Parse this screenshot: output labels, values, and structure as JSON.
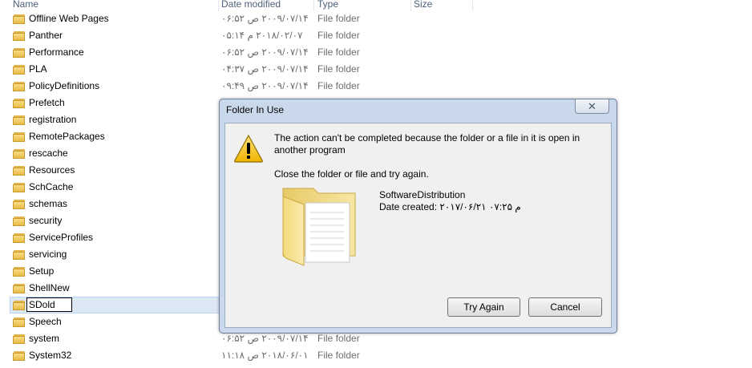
{
  "columns": {
    "name": "Name",
    "date_modified": "Date modified",
    "type": "Type",
    "size": "Size"
  },
  "files": [
    {
      "name": "Offline Web Pages",
      "date": "۲۰۰۹/۰۷/۱۴ ص ۰۶:۵۲",
      "type": "File folder"
    },
    {
      "name": "Panther",
      "date": "۲۰۱۸/۰۲/۰۷ م ۰۵:۱۴",
      "type": "File folder"
    },
    {
      "name": "Performance",
      "date": "۲۰۰۹/۰۷/۱۴ ص ۰۶:۵۲",
      "type": "File folder"
    },
    {
      "name": "PLA",
      "date": "۲۰۰۹/۰۷/۱۴ ص ۰۴:۳۷",
      "type": "File folder"
    },
    {
      "name": "PolicyDefinitions",
      "date": "۲۰۰۹/۰۷/۱۴ ص ۰۹:۴۹",
      "type": "File folder"
    },
    {
      "name": "Prefetch",
      "date": "",
      "type": ""
    },
    {
      "name": "registration",
      "date": "",
      "type": ""
    },
    {
      "name": "RemotePackages",
      "date": "",
      "type": ""
    },
    {
      "name": "rescache",
      "date": "",
      "type": ""
    },
    {
      "name": "Resources",
      "date": "",
      "type": ""
    },
    {
      "name": "SchCache",
      "date": "",
      "type": ""
    },
    {
      "name": "schemas",
      "date": "",
      "type": ""
    },
    {
      "name": "security",
      "date": "",
      "type": ""
    },
    {
      "name": "ServiceProfiles",
      "date": "",
      "type": ""
    },
    {
      "name": "servicing",
      "date": "",
      "type": ""
    },
    {
      "name": "Setup",
      "date": "",
      "type": ""
    },
    {
      "name": "ShellNew",
      "date": "",
      "type": ""
    },
    {
      "name": "SDold",
      "date": "",
      "type": "",
      "renaming": true
    },
    {
      "name": "Speech",
      "date": "",
      "type": ""
    },
    {
      "name": "system",
      "date": "۲۰۰۹/۰۷/۱۴ ص ۰۶:۵۲",
      "type": "File folder"
    },
    {
      "name": "System32",
      "date": "۲۰۱۸/۰۶/۰۱ ص ۱۱:۱۸",
      "type": "File folder"
    }
  ],
  "dialog": {
    "title": "Folder In Use",
    "close_label": "✕",
    "message_line": "The action can't be completed because the folder or a file in it is open in another program",
    "message_hint": "Close the folder or file and try again.",
    "item_name": "SoftwareDistribution",
    "item_date": "Date created: ۲۰۱۷/۰۶/۲۱ م ۰۷:۲۵",
    "try_again_label": "Try Again",
    "cancel_label": "Cancel",
    "icon_name": "warning-icon"
  },
  "colors": {
    "header_text": "#4c607a",
    "selection_bg": "#dde8f5",
    "dialog_frame": "#c9d8ea"
  }
}
